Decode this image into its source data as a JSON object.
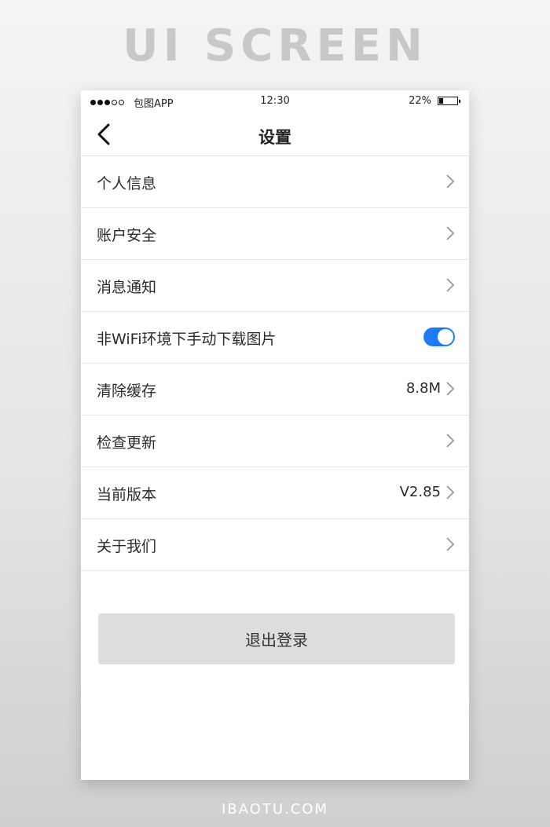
{
  "banner": {
    "title": "UI SCREEN",
    "footer": "IBAOTU.COM"
  },
  "status_bar": {
    "carrier": "包图APP",
    "time": "12:30",
    "battery_percent": "22%",
    "battery_level": 0.22,
    "signal_bars_filled": 3,
    "signal_bars_total": 5
  },
  "nav": {
    "title": "设置",
    "back_icon": "chevron-left-icon"
  },
  "settings": {
    "items": [
      {
        "label": "个人信息",
        "value": "",
        "control": "chevron"
      },
      {
        "label": "账户安全",
        "value": "",
        "control": "chevron"
      },
      {
        "label": "消息通知",
        "value": "",
        "control": "chevron"
      },
      {
        "label": "非WiFi环境下手动下载图片",
        "value": "",
        "control": "toggle",
        "toggle_on": true
      },
      {
        "label": "清除缓存",
        "value": "8.8M",
        "control": "chevron"
      },
      {
        "label": "检查更新",
        "value": "",
        "control": "chevron"
      },
      {
        "label": "当前版本",
        "value": "V2.85",
        "control": "chevron"
      },
      {
        "label": "关于我们",
        "value": "",
        "control": "chevron"
      }
    ]
  },
  "logout": {
    "label": "退出登录"
  },
  "colors": {
    "accent": "#1e7bf5",
    "button_bg": "#dddddd",
    "divider": "#e8e8e8"
  }
}
